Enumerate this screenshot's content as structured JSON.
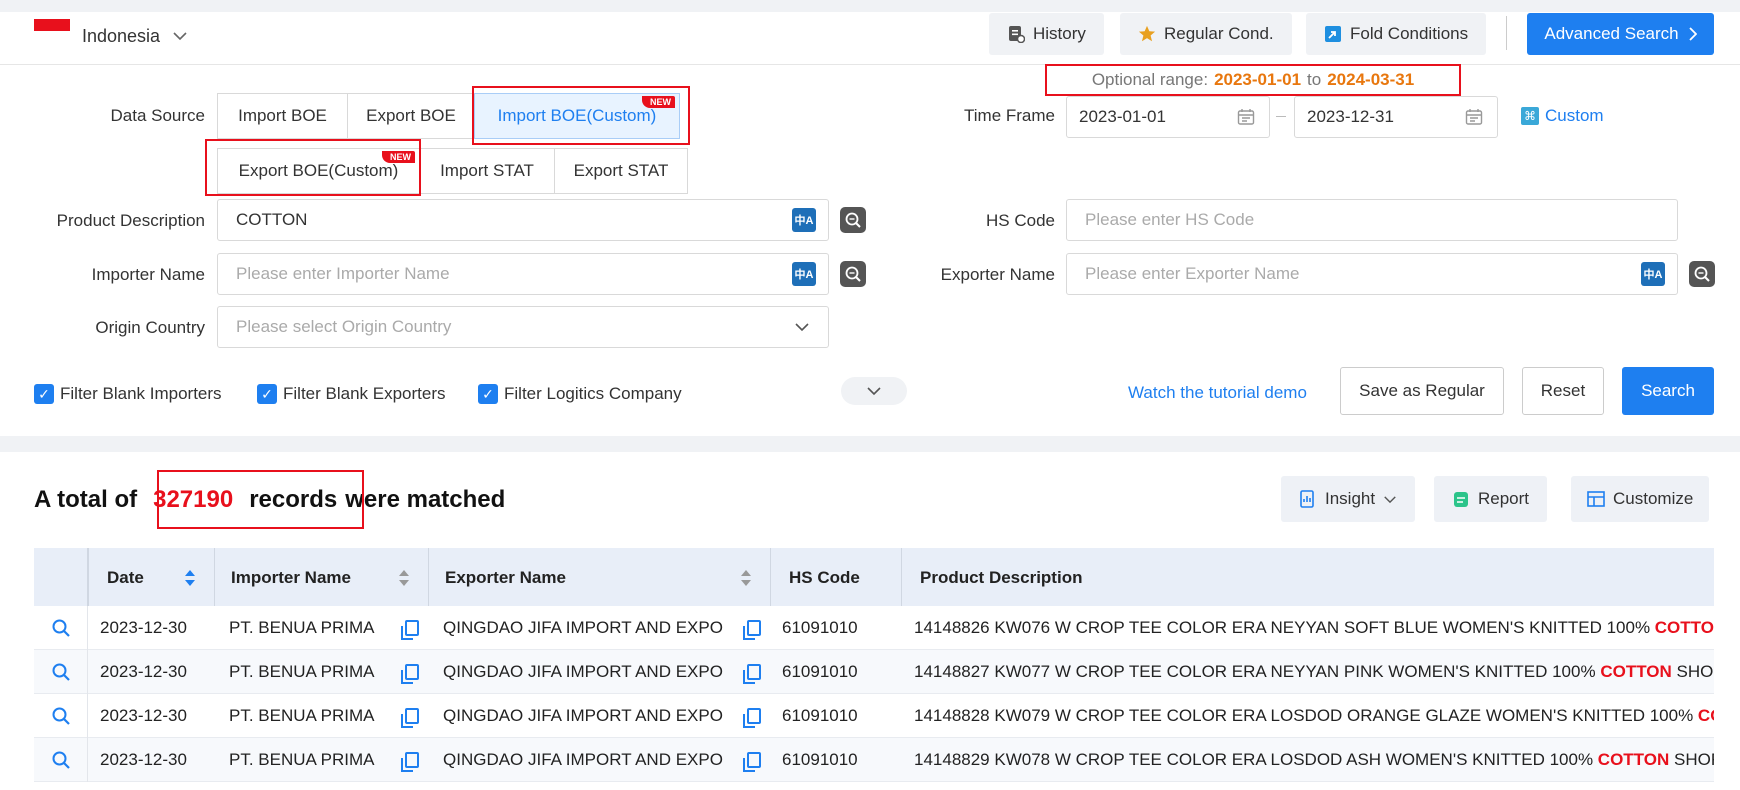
{
  "header": {
    "country": "Indonesia",
    "history": "History",
    "regular_cond": "Regular Cond.",
    "fold_conditions": "Fold Conditions",
    "advanced_search": "Advanced Search"
  },
  "optional_range": {
    "label": "Optional range:",
    "from": "2023-01-01",
    "to_word": "to",
    "to": "2024-03-31"
  },
  "form": {
    "data_source_label": "Data Source",
    "data_sources": [
      "Import BOE",
      "Export BOE",
      "Import BOE(Custom)",
      "Export BOE(Custom)",
      "Import STAT",
      "Export STAT"
    ],
    "new_badge": "NEW",
    "time_frame_label": "Time Frame",
    "time_from": "2023-01-01",
    "time_to": "2023-12-31",
    "custom": "Custom",
    "product_label": "Product Description",
    "product_value": "COTTON",
    "hs_label": "HS Code",
    "hs_placeholder": "Please enter HS Code",
    "importer_label": "Importer Name",
    "importer_placeholder": "Please enter Importer Name",
    "exporter_label": "Exporter Name",
    "exporter_placeholder": "Please enter Exporter Name",
    "origin_label": "Origin Country",
    "origin_placeholder": "Please select Origin Country",
    "filter_importers": "Filter Blank Importers",
    "filter_exporters": "Filter Blank Exporters",
    "filter_logistics": "Filter Logitics Company",
    "tutorial": "Watch the tutorial demo",
    "save_regular": "Save as Regular",
    "reset": "Reset",
    "search": "Search"
  },
  "results": {
    "prefix": "A total of",
    "count": "327190",
    "records": "records",
    "suffix": "were matched",
    "insight": "Insight",
    "report": "Report",
    "customize": "Customize"
  },
  "table": {
    "headers": [
      "Date",
      "Importer Name",
      "Exporter Name",
      "HS Code",
      "Product Description"
    ],
    "rows": [
      {
        "date": "2023-12-30",
        "importer": "PT. BENUA PRIMA",
        "exporter": "QINGDAO JIFA IMPORT AND EXPO",
        "hs": "61091010",
        "desc": "14148826 KW076 W CROP TEE COLOR ERA NEYYAN SOFT BLUE WOMEN'S KNITTED 100% ",
        "hl": "COTTON",
        "tail": ""
      },
      {
        "date": "2023-12-30",
        "importer": "PT. BENUA PRIMA",
        "exporter": "QINGDAO JIFA IMPORT AND EXPO",
        "hs": "61091010",
        "desc": "14148827 KW077 W CROP TEE COLOR ERA NEYYAN PINK WOMEN'S KNITTED 100% ",
        "hl": "COTTON",
        "tail": " SHORT"
      },
      {
        "date": "2023-12-30",
        "importer": "PT. BENUA PRIMA",
        "exporter": "QINGDAO JIFA IMPORT AND EXPO",
        "hs": "61091010",
        "desc": "14148828 KW079 W CROP TEE COLOR ERA LOSDOD ORANGE GLAZE WOMEN'S KNITTED 100% ",
        "hl": "COTTON",
        "tail": ""
      },
      {
        "date": "2023-12-30",
        "importer": "PT. BENUA PRIMA",
        "exporter": "QINGDAO JIFA IMPORT AND EXPO",
        "hs": "61091010",
        "desc": "14148829 KW078 W CROP TEE COLOR ERA LOSDOD ASH WOMEN'S KNITTED 100% ",
        "hl": "COTTON",
        "tail": " SHORT"
      }
    ]
  },
  "colors": {
    "accent": "#1e7ff0",
    "highlight": "#e8101c",
    "range": "#e8770e"
  }
}
